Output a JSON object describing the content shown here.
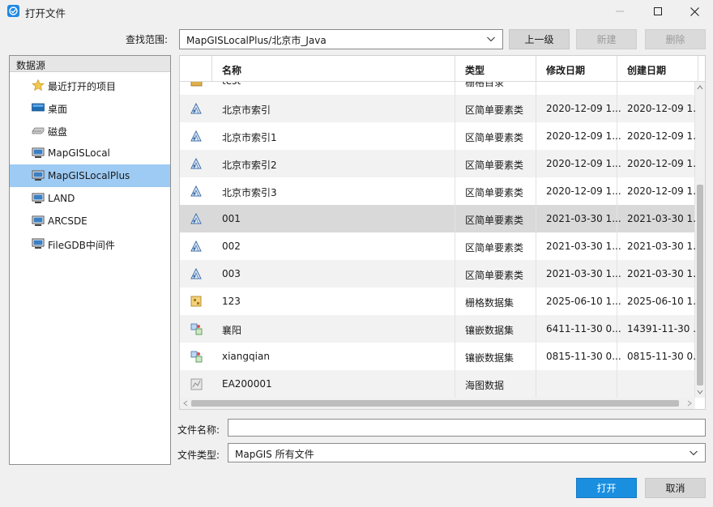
{
  "window": {
    "title": "打开文件",
    "accent": "#1a8fe0"
  },
  "lookup": {
    "label": "查找范围:",
    "value": "MapGISLocalPlus/北京市_Java"
  },
  "toolbar": {
    "up_label": "上一级",
    "new_label": "新建",
    "delete_label": "删除"
  },
  "sidebar": {
    "header": "数据源",
    "items": [
      {
        "label": "最近打开的项目",
        "icon": "star-icon"
      },
      {
        "label": "桌面",
        "icon": "desktop-icon"
      },
      {
        "label": "磁盘",
        "icon": "disk-icon"
      },
      {
        "label": "MapGISLocal",
        "icon": "computer-icon"
      },
      {
        "label": "MapGISLocalPlus",
        "icon": "computer-icon",
        "selected": true
      },
      {
        "label": "LAND",
        "icon": "computer-icon"
      },
      {
        "label": "ARCSDE",
        "icon": "computer-icon"
      },
      {
        "label": "FileGDB中间件",
        "icon": "computer-icon"
      }
    ]
  },
  "table": {
    "columns": [
      "名称",
      "类型",
      "修改日期",
      "创建日期"
    ],
    "rows": [
      {
        "name": "test",
        "type": "栅格目录",
        "modified": "",
        "created": "",
        "icon": "raster-catalog-icon"
      },
      {
        "name": "北京市索引",
        "type": "区简单要素类",
        "modified": "2020-12-09 1...",
        "created": "2020-12-09 1...",
        "icon": "polygon-feature-icon"
      },
      {
        "name": "北京市索引1",
        "type": "区简单要素类",
        "modified": "2020-12-09 1...",
        "created": "2020-12-09 1...",
        "icon": "polygon-feature-icon"
      },
      {
        "name": "北京市索引2",
        "type": "区简单要素类",
        "modified": "2020-12-09 1...",
        "created": "2020-12-09 1...",
        "icon": "polygon-feature-icon"
      },
      {
        "name": "北京市索引3",
        "type": "区简单要素类",
        "modified": "2020-12-09 1...",
        "created": "2020-12-09 1...",
        "icon": "polygon-feature-icon"
      },
      {
        "name": "001",
        "type": "区简单要素类",
        "modified": "2021-03-30 1...",
        "created": "2021-03-30 1...",
        "icon": "polygon-feature-icon",
        "selected": true
      },
      {
        "name": "002",
        "type": "区简单要素类",
        "modified": "2021-03-30 1...",
        "created": "2021-03-30 1...",
        "icon": "polygon-feature-icon"
      },
      {
        "name": "003",
        "type": "区简单要素类",
        "modified": "2021-03-30 1...",
        "created": "2021-03-30 1...",
        "icon": "polygon-feature-icon"
      },
      {
        "name": "123",
        "type": "栅格数据集",
        "modified": "2025-06-10 1...",
        "created": "2025-06-10 1...",
        "icon": "raster-dataset-icon"
      },
      {
        "name": "襄阳",
        "type": "镶嵌数据集",
        "modified": "6411-11-30 0...",
        "created": "14391-11-30 ...",
        "icon": "mosaic-dataset-icon"
      },
      {
        "name": "xiangqian",
        "type": "镶嵌数据集",
        "modified": "0815-11-30 0...",
        "created": "0815-11-30 0...",
        "icon": "mosaic-dataset-icon"
      },
      {
        "name": "EA200001",
        "type": "海图数据",
        "modified": "",
        "created": "",
        "icon": "chart-data-icon"
      }
    ]
  },
  "filename": {
    "label": "文件名称:",
    "value": ""
  },
  "filetype": {
    "label": "文件类型:",
    "value": "MapGIS 所有文件"
  },
  "actions": {
    "open_label": "打开",
    "cancel_label": "取消"
  }
}
